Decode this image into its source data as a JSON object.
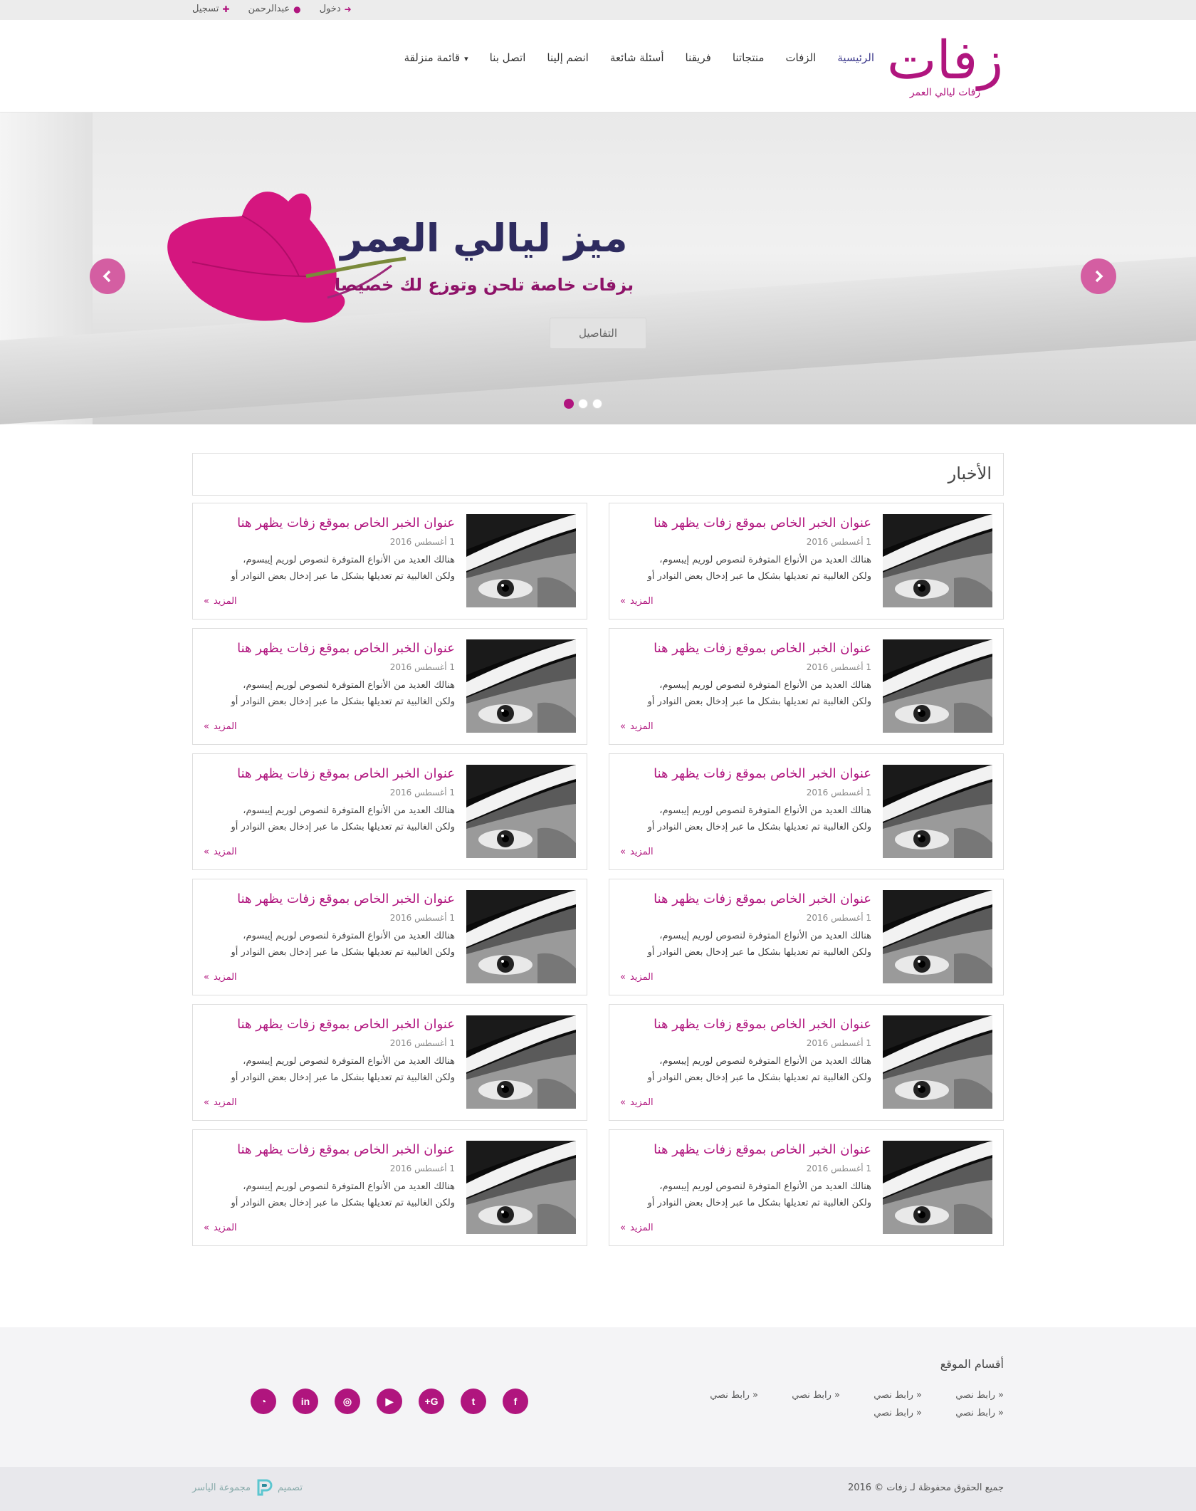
{
  "topbar": {
    "login": "دخول",
    "user": "عبدالرحمن",
    "register": "تسجيل"
  },
  "logo": {
    "word": "زفات",
    "tagline": "زفات ليالي العمر"
  },
  "nav": [
    "الرئيسية",
    "الزفات",
    "منتجاتنا",
    "فريقنا",
    "أسئلة شائعة",
    "انضم إلينا",
    "اتصل بنا",
    "قائمة منزلقة"
  ],
  "slider": {
    "title": "ميز ليالي العمر",
    "subtitle": "بزفات خاصة تلحن وتوزع لك خصيصا",
    "button": "التفاصيل",
    "active_dot": 3,
    "dot_count": 3
  },
  "news": {
    "heading": "الأخبار",
    "item": {
      "title": "عنوان الخبر الخاص بموقع زفات يظهر هنا",
      "date": "1 أغسطس 2016",
      "line1": "هنالك العديد من الأنواع المتوفرة لنصوص لوريم إيبسوم،",
      "line2": "ولكن الغالبية تم تعديلها بشكل ما عبر إدخال بعض النوادر أو",
      "more": "المزيد"
    }
  },
  "footer": {
    "title": "أقسام الموقع",
    "links": [
      "رابط نصي",
      "رابط نصي",
      "رابط نصي",
      "رابط نصي",
      "رابط نصي",
      "رابط نصي"
    ],
    "social": [
      "facebook-icon",
      "twitter-icon",
      "google-plus-icon",
      "youtube-icon",
      "instagram-icon",
      "linkedin-icon",
      "rss-icon"
    ],
    "copyright": "جميع الحقوق محفوظة لـ زفات © 2016",
    "design_label": "تصميم",
    "design_by": "مجموعة الياسر"
  },
  "colors": {
    "brand": "#b0157e",
    "title_dark": "#2e2b5f",
    "nav_active": "#3d3a8c"
  }
}
